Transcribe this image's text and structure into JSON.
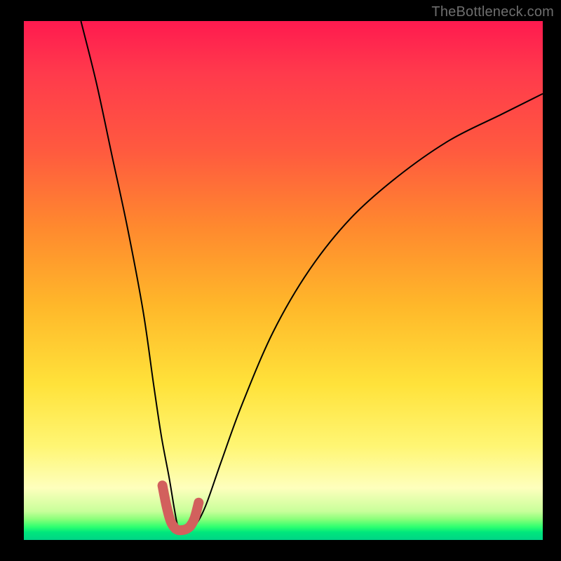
{
  "watermark": "TheBottleneck.com",
  "chart_data": {
    "type": "line",
    "title": "",
    "xlabel": "",
    "ylabel": "",
    "xlim": [
      0,
      100
    ],
    "ylim": [
      0,
      100
    ],
    "grid": false,
    "series": [
      {
        "name": "bottleneck-curve",
        "type": "line",
        "color": "#000000",
        "width": 2,
        "x": [
          11,
          14,
          17,
          20,
          23,
          25,
          26.5,
          28,
          29,
          29.7,
          30.5,
          31.5,
          33,
          35,
          38,
          42,
          48,
          55,
          63,
          72,
          82,
          92,
          100
        ],
        "y": [
          100,
          88,
          74,
          60,
          44,
          30,
          20,
          12,
          6,
          2.6,
          2.4,
          2.4,
          2.8,
          6.5,
          15,
          26,
          40,
          52,
          62,
          70,
          77,
          82,
          86
        ]
      },
      {
        "name": "optimal-range-marker",
        "type": "line",
        "color": "#d2605d",
        "width": 14,
        "linecap": "round",
        "x": [
          26.7,
          27.5,
          28.3,
          29.1,
          29.8,
          30.5,
          31.3,
          32.1,
          32.9,
          33.7
        ],
        "y": [
          10.5,
          6.5,
          3.6,
          2.3,
          1.9,
          1.9,
          2.1,
          2.7,
          4.2,
          7.2
        ]
      }
    ]
  }
}
